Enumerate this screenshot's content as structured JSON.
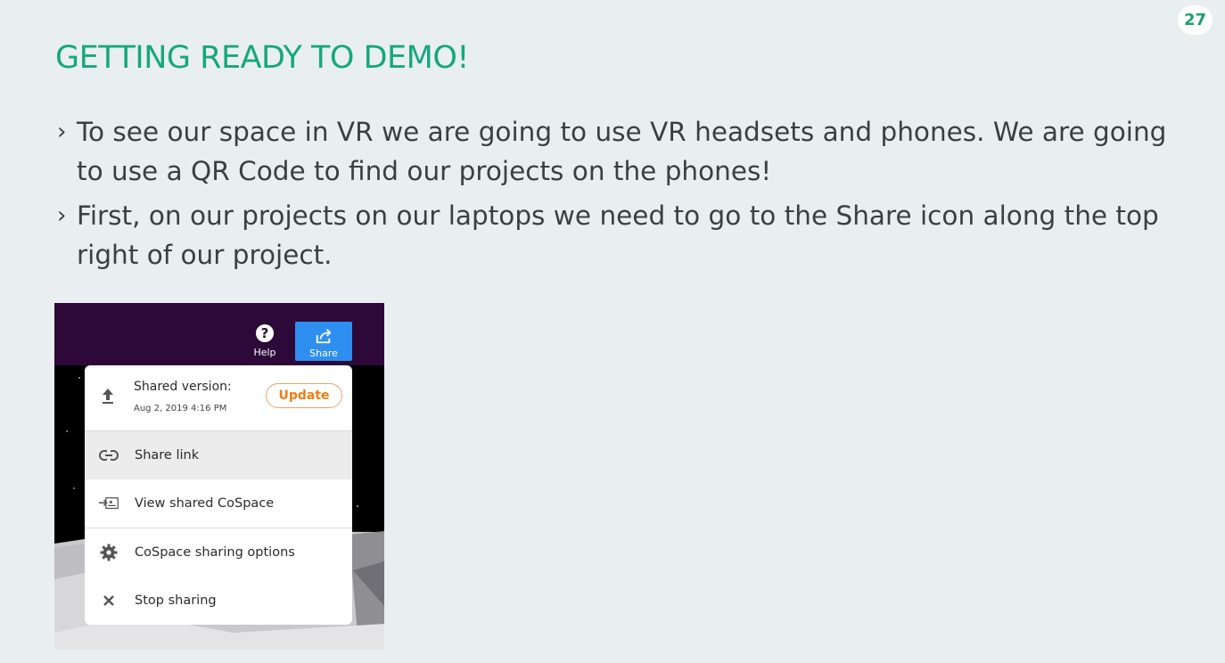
{
  "slide": {
    "page_number": "27",
    "title": "GETTING READY TO DEMO!",
    "bullet_mark": "›",
    "bullets": [
      "To see our space in VR we are going to use VR headsets and phones. We are going to use a QR Code to find our projects on the phones!",
      "First, on our projects on our laptops we need to go to the Share icon along the top right of our project."
    ]
  },
  "screenshot": {
    "toolbar": {
      "help_label": "Help",
      "help_icon_glyph": "?",
      "share_label": "Share"
    },
    "share_menu": {
      "shared_version_label": "Shared version:",
      "shared_date": "Aug 2, 2019 4:16 PM",
      "update_label": "Update",
      "items": [
        {
          "label": "Share link",
          "icon": "link-icon"
        },
        {
          "label": "View shared CoSpace",
          "icon": "view-shared-icon"
        },
        {
          "label": "CoSpace sharing options",
          "icon": "gear-icon"
        },
        {
          "label": "Stop sharing",
          "icon": "close-icon"
        }
      ]
    }
  },
  "colors": {
    "background": "#e9eff0",
    "title": "#16a879",
    "body_text": "#3b3f42",
    "toolbar": "#2c0939",
    "share_button": "#2f8ff0",
    "update_text": "#ef7d11"
  }
}
